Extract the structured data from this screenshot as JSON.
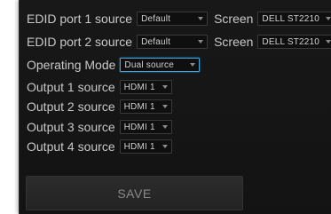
{
  "rows": [
    {
      "label": "EDID port 1 source",
      "value": "Default",
      "screen_label": "Screen",
      "screen_value": "DELL ST2210"
    },
    {
      "label": "EDID port 2 source",
      "value": "Default",
      "screen_label": "Screen",
      "screen_value": "DELL ST2210"
    }
  ],
  "operating_mode": {
    "label": "Operating Mode",
    "value": "Dual source"
  },
  "outputs": [
    {
      "label": "Output 1 source",
      "value": "HDMI 1"
    },
    {
      "label": "Output 2 source",
      "value": "HDMI 1"
    },
    {
      "label": "Output 3 source",
      "value": "HDMI 1"
    },
    {
      "label": "Output 4 source",
      "value": "HDMI 1"
    }
  ],
  "save_label": "SAVE",
  "colors": {
    "panel_bg": "#181818",
    "text": "#c8c8c8",
    "focus_border": "#4aa3d6"
  }
}
